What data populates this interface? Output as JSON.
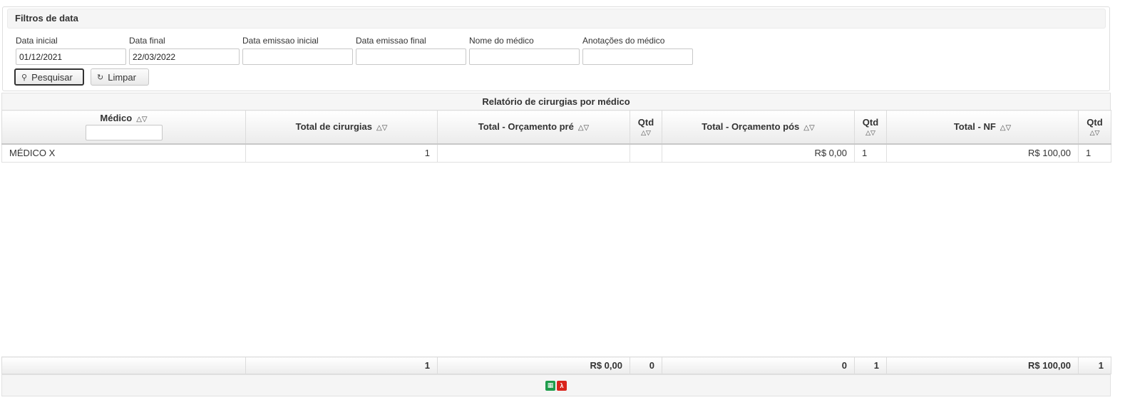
{
  "filters": {
    "title": "Filtros de data",
    "fields": [
      {
        "label": "Data inicial",
        "value": "01/12/2021"
      },
      {
        "label": "Data final",
        "value": "22/03/2022"
      },
      {
        "label": "Data emissao inicial",
        "value": ""
      },
      {
        "label": "Data emissao final",
        "value": ""
      },
      {
        "label": "Nome do médico",
        "value": ""
      },
      {
        "label": "Anotações do médico",
        "value": ""
      }
    ],
    "search_label": "Pesquisar",
    "clear_label": "Limpar"
  },
  "report": {
    "title": "Relatório de cirurgias por médico",
    "columns": [
      "Médico",
      "Total de cirurgias",
      "Total - Orçamento pré",
      "Qtd",
      "Total - Orçamento pós",
      "Qtd",
      "Total - NF",
      "Qtd"
    ],
    "rows": [
      [
        "MÉDICO X",
        "1",
        "",
        "",
        "R$ 0,00",
        "1",
        "R$ 100,00",
        "1"
      ]
    ],
    "totals": [
      "",
      "1",
      "R$ 0,00",
      "0",
      "0",
      "1",
      "R$ 100,00",
      "1"
    ]
  },
  "export": {
    "icons": [
      "excel-icon",
      "pdf-icon"
    ],
    "colors": {
      "excel": "#1e9c4b",
      "pdf": "#d9241c"
    }
  }
}
